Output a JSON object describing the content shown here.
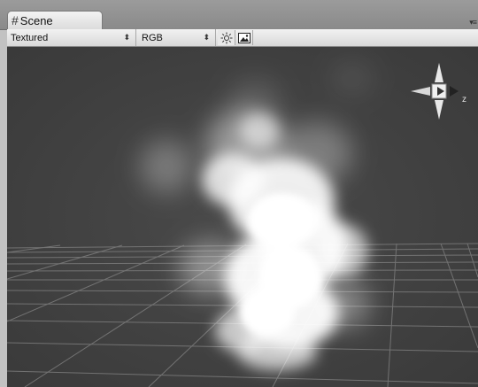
{
  "tab": {
    "title": "Scene",
    "icon": "grid-hash-icon"
  },
  "toolbar": {
    "shading_mode": "Textured",
    "channel_mode": "RGB",
    "lighting_icon": "sun-icon",
    "image_icon": "image-icon"
  },
  "gizmo": {
    "axis_label": "z"
  },
  "colors": {
    "viewport_bg": "#414141",
    "grid_line": "#8a8a8a",
    "smoke": "#ffffff"
  }
}
